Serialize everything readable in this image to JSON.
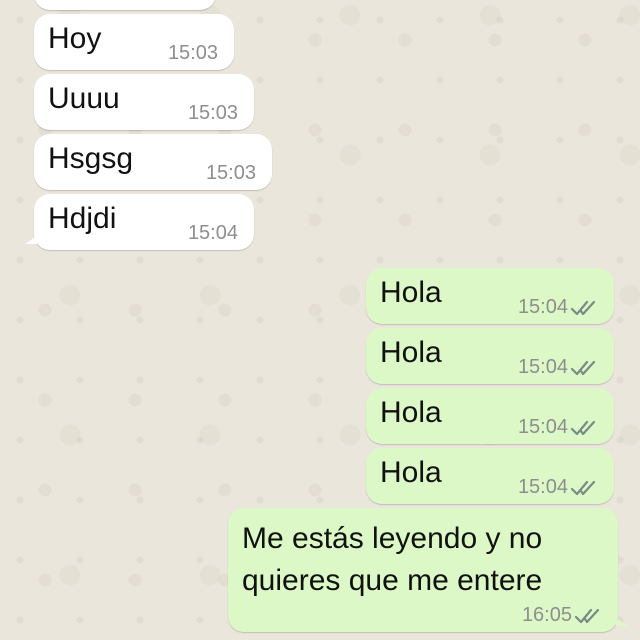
{
  "chat": {
    "incoming": [
      {
        "text": "Hoy",
        "time": "15:03"
      },
      {
        "text": "Uuuu",
        "time": "15:03"
      },
      {
        "text": "Hsgsg",
        "time": "15:03"
      },
      {
        "text": "Hdjdi",
        "time": "15:04"
      }
    ],
    "outgoing": [
      {
        "text": "Hola",
        "time": "15:04"
      },
      {
        "text": "Hola",
        "time": "15:04"
      },
      {
        "text": "Hola",
        "time": "15:04"
      },
      {
        "text": "Hola",
        "time": "15:04"
      },
      {
        "text": "Me estás leyendo y no quieres que me entere",
        "time": "16:05"
      }
    ],
    "colors": {
      "incoming_bubble": "#ffffff",
      "outgoing_bubble": "#dcf8c6",
      "tick": "#7a8a86",
      "timestamp": "#8e8e8e"
    },
    "icons": {
      "read_receipt": "double-check-icon"
    }
  }
}
